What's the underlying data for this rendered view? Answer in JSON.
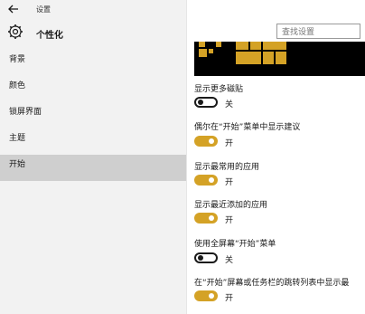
{
  "window": {
    "title": "设置"
  },
  "header": {
    "title": "个性化"
  },
  "search": {
    "placeholder": "查找设置"
  },
  "nav": {
    "items": [
      {
        "label": "背景"
      },
      {
        "label": "颜色"
      },
      {
        "label": "锁屏界面"
      },
      {
        "label": "主题"
      },
      {
        "label": "开始"
      }
    ],
    "active": "开始"
  },
  "colors": {
    "accent": "#d4a226"
  },
  "settings": [
    {
      "label": "显示更多磁贴",
      "state": "关",
      "on": false
    },
    {
      "label": "偶尔在“开始”菜单中显示建议",
      "state": "开",
      "on": true
    },
    {
      "label": "显示最常用的应用",
      "state": "开",
      "on": true
    },
    {
      "label": "显示最近添加的应用",
      "state": "开",
      "on": true
    },
    {
      "label": "使用全屏幕“开始”菜单",
      "state": "关",
      "on": false
    },
    {
      "label": "在“开始”屏幕或任务栏的跳转列表中显示最",
      "state": "开",
      "on": true
    }
  ]
}
